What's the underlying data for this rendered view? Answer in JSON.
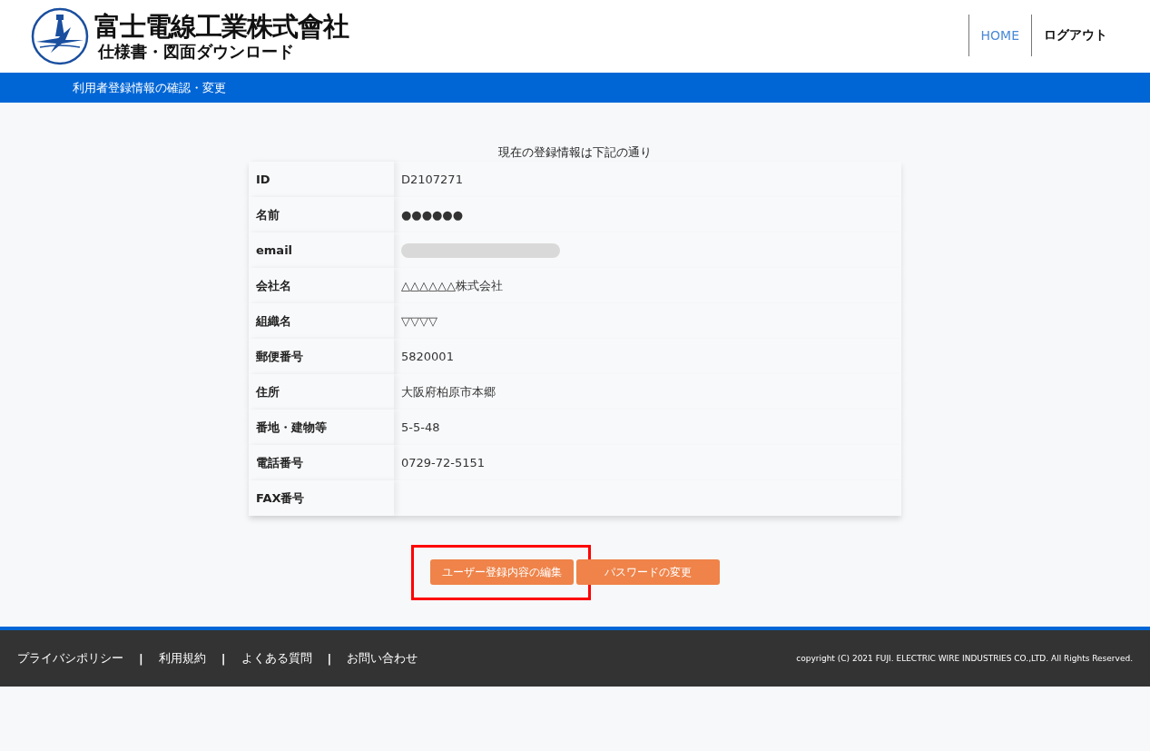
{
  "header": {
    "logo": {
      "company": "富士電線工業株式會社",
      "subtitle": "仕様書・図面ダウンロード"
    },
    "nav": [
      {
        "label": "HOME",
        "selected": true
      },
      {
        "label": "ログアウト",
        "selected": false
      }
    ]
  },
  "breadcrumb_bar": {
    "title": "利用者登録情報の確認・変更"
  },
  "intro": "現在の登録情報は下記の通り",
  "table": {
    "rows": [
      {
        "label": "ID",
        "kind": "text",
        "value": "D2107271"
      },
      {
        "label": "名前",
        "kind": "text",
        "value": "●●●●●●"
      },
      {
        "label": "email",
        "kind": "redacted"
      },
      {
        "label": "会社名",
        "kind": "text",
        "value": "△△△△△△株式会社"
      },
      {
        "label": "組織名",
        "kind": "text",
        "value": "▽▽▽▽"
      },
      {
        "label": "郵便番号",
        "kind": "text",
        "value": "5820001"
      },
      {
        "label": "住所",
        "kind": "text",
        "value": "大阪府柏原市本郷"
      },
      {
        "label": "番地・建物等",
        "kind": "text",
        "value": "5-5-48"
      },
      {
        "label": "電話番号",
        "kind": "text",
        "value": "0729-72-5151"
      },
      {
        "label": "FAX番号",
        "kind": "text"
      }
    ]
  },
  "buttons": [
    {
      "label": "ユーザー登録内容の編集",
      "highlighted": true
    },
    {
      "label": "パスワードの変更",
      "highlighted": false
    }
  ],
  "footer": {
    "separator": "|",
    "links": [
      "プライバシポリシー",
      "利用規約",
      "よくある質問",
      "お問い合わせ"
    ],
    "copyright": "copyright (C) 2021 FUJI. ELECTRIC WIRE INDUSTRIES CO.,LTD. All Rights Reserved."
  }
}
